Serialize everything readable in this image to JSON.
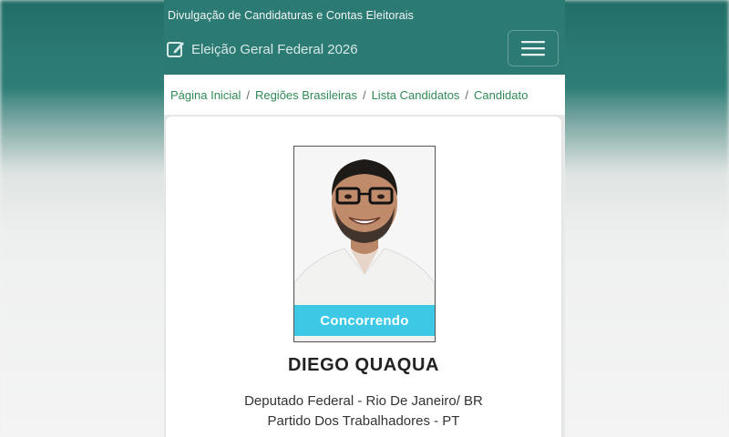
{
  "header": {
    "site_title": "Divulgação de Candidaturas e Contas Eleitorais",
    "brand_label": "Eleição Geral Federal 2026",
    "brand_icon": "edit-icon",
    "menu_icon": "hamburger-menu-icon"
  },
  "breadcrumb": {
    "items": [
      "Página Inicial",
      "Regiões Brasileiras",
      "Lista Candidatos",
      "Candidato"
    ],
    "separator": "/"
  },
  "candidate": {
    "status": "Concorrendo",
    "name": "DIEGO QUAQUA",
    "role": "Deputado Federal - Rio De Janeiro/ BR",
    "party": "Partido Dos Trabalhadores - PT"
  },
  "colors": {
    "header_bg": "#2b7a73",
    "breadcrumb_link": "#2f8a55",
    "status_badge": "#3dc9e6"
  }
}
